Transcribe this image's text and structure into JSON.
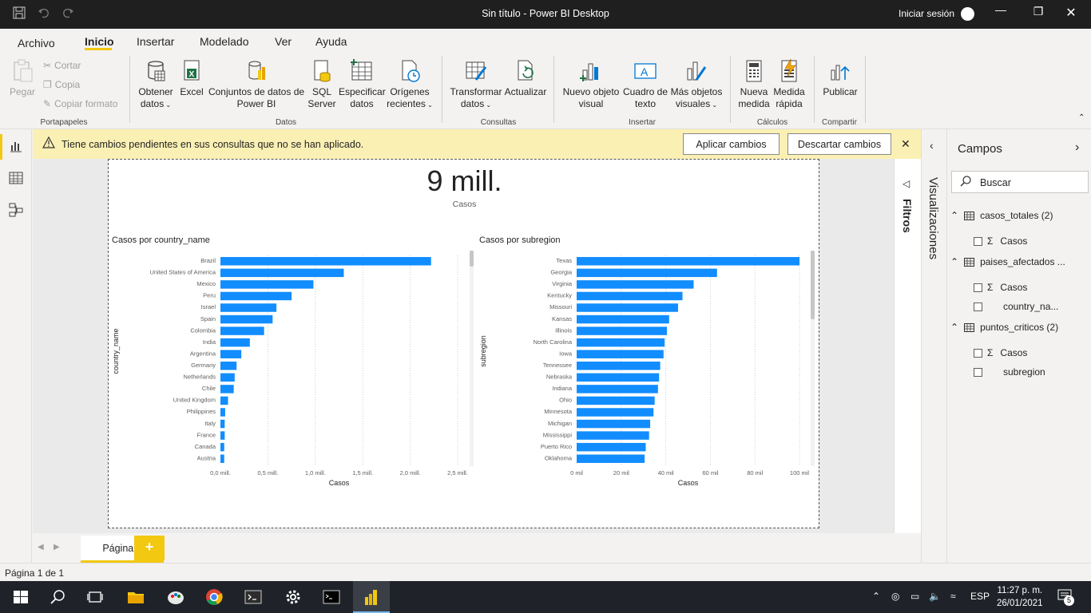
{
  "window": {
    "title": "Sin título - Power BI Desktop",
    "signin": "Iniciar sesión"
  },
  "menu": {
    "items": [
      "Archivo",
      "Inicio",
      "Insertar",
      "Modelado",
      "Ver",
      "Ayuda"
    ],
    "active": "Inicio"
  },
  "ribbon": {
    "paste": "Pegar",
    "cut": "Cortar",
    "copy": "Copia",
    "format_painter": "Copiar formato",
    "group_clipboard": "Portapapeles",
    "get_data_1": "Obtener",
    "get_data_2": "datos",
    "excel": "Excel",
    "datasets_1": "Conjuntos de datos de",
    "datasets_2": "Power BI",
    "sql_1": "SQL",
    "sql_2": "Server",
    "enter_1": "Especificar",
    "enter_2": "datos",
    "recent_1": "Orígenes",
    "recent_2": "recientes",
    "group_data": "Datos",
    "transform_1": "Transformar",
    "transform_2": "datos",
    "refresh": "Actualizar",
    "group_queries": "Consultas",
    "newvisual_1": "Nuevo objeto",
    "newvisual_2": "visual",
    "textbox_1": "Cuadro de",
    "textbox_2": "texto",
    "morevisuals_1": "Más objetos",
    "morevisuals_2": "visuales",
    "group_insert": "Insertar",
    "newmeasure_1": "Nueva",
    "newmeasure_2": "medida",
    "quickmeasure_1": "Medida",
    "quickmeasure_2": "rápida",
    "group_calc": "Cálculos",
    "publish": "Publicar",
    "group_share": "Compartir"
  },
  "warning": {
    "text": "Tiene cambios pendientes en sus consultas que no se han aplicado.",
    "apply": "Aplicar cambios",
    "discard": "Descartar cambios"
  },
  "card": {
    "value": "9 mill.",
    "label": "Casos"
  },
  "chart_data": [
    {
      "type": "bar",
      "orientation": "horizontal",
      "title": "Casos por country_name",
      "xlabel": "Casos",
      "ylabel": "country_name",
      "categories": [
        "Brazil",
        "United States of America",
        "Mexico",
        "Peru",
        "Israel",
        "Spain",
        "Colombia",
        "India",
        "Argentina",
        "Germany",
        "Netherlands",
        "Chile",
        "United Kingdom",
        "Philippines",
        "Italy",
        "France",
        "Canada",
        "Austria"
      ],
      "values": [
        2220000,
        1300000,
        980000,
        750000,
        590000,
        550000,
        460000,
        310000,
        220000,
        170000,
        150000,
        140000,
        80000,
        50000,
        45000,
        45000,
        40000,
        40000
      ],
      "xlim": [
        0,
        2500000
      ],
      "ticks": [
        0,
        500000,
        1000000,
        1500000,
        2000000,
        2500000
      ],
      "tick_labels": [
        "0,0 mill.",
        "0,5 mill.",
        "1,0 mill.",
        "1,5 mill.",
        "2,0 mill.",
        "2,5 mill."
      ],
      "color": "#118dff",
      "grid": true
    },
    {
      "type": "bar",
      "orientation": "horizontal",
      "title": "Casos por subregion",
      "xlabel": "Casos",
      "ylabel": "subregion",
      "categories": [
        "Texas",
        "Georgia",
        "Virginia",
        "Kentucky",
        "Missouri",
        "Kansas",
        "Illinois",
        "North Carolina",
        "Iowa",
        "Tennessee",
        "Nebraska",
        "Indiana",
        "Ohio",
        "Minnesota",
        "Michigan",
        "Mississippi",
        "Puerto Rico",
        "Oklahoma"
      ],
      "values": [
        100000,
        63000,
        52500,
        47500,
        45500,
        41500,
        40500,
        39500,
        39000,
        37500,
        37000,
        36500,
        35000,
        34500,
        33000,
        32500,
        31000,
        30500
      ],
      "xlim": [
        0,
        100000
      ],
      "ticks": [
        0,
        20000,
        40000,
        60000,
        80000,
        100000
      ],
      "tick_labels": [
        "0 mil",
        "20 mil",
        "40 mil",
        "60 mil",
        "80 mil",
        "100 mil"
      ],
      "color": "#118dff",
      "grid": true
    }
  ],
  "side": {
    "filters": "Filtros",
    "visualizations": "Visualizaciones"
  },
  "fields": {
    "title": "Campos",
    "search_placeholder": "Buscar",
    "tables": [
      {
        "name": "casos_totales (2)",
        "fields": [
          {
            "name": "Casos",
            "sigma": true
          }
        ]
      },
      {
        "name": "paises_afectados ...",
        "fields": [
          {
            "name": "Casos",
            "sigma": true
          },
          {
            "name": "country_na...",
            "sigma": false
          }
        ]
      },
      {
        "name": "puntos_criticos (2)",
        "fields": [
          {
            "name": "Casos",
            "sigma": true
          },
          {
            "name": "subregion",
            "sigma": false
          }
        ]
      }
    ]
  },
  "pages": {
    "tab": "Página 1",
    "add": "+"
  },
  "status": "Página 1 de 1",
  "taskbar": {
    "lang": "ESP",
    "time": "11:27 p. m.",
    "date": "26/01/2021",
    "notifications": "5"
  }
}
